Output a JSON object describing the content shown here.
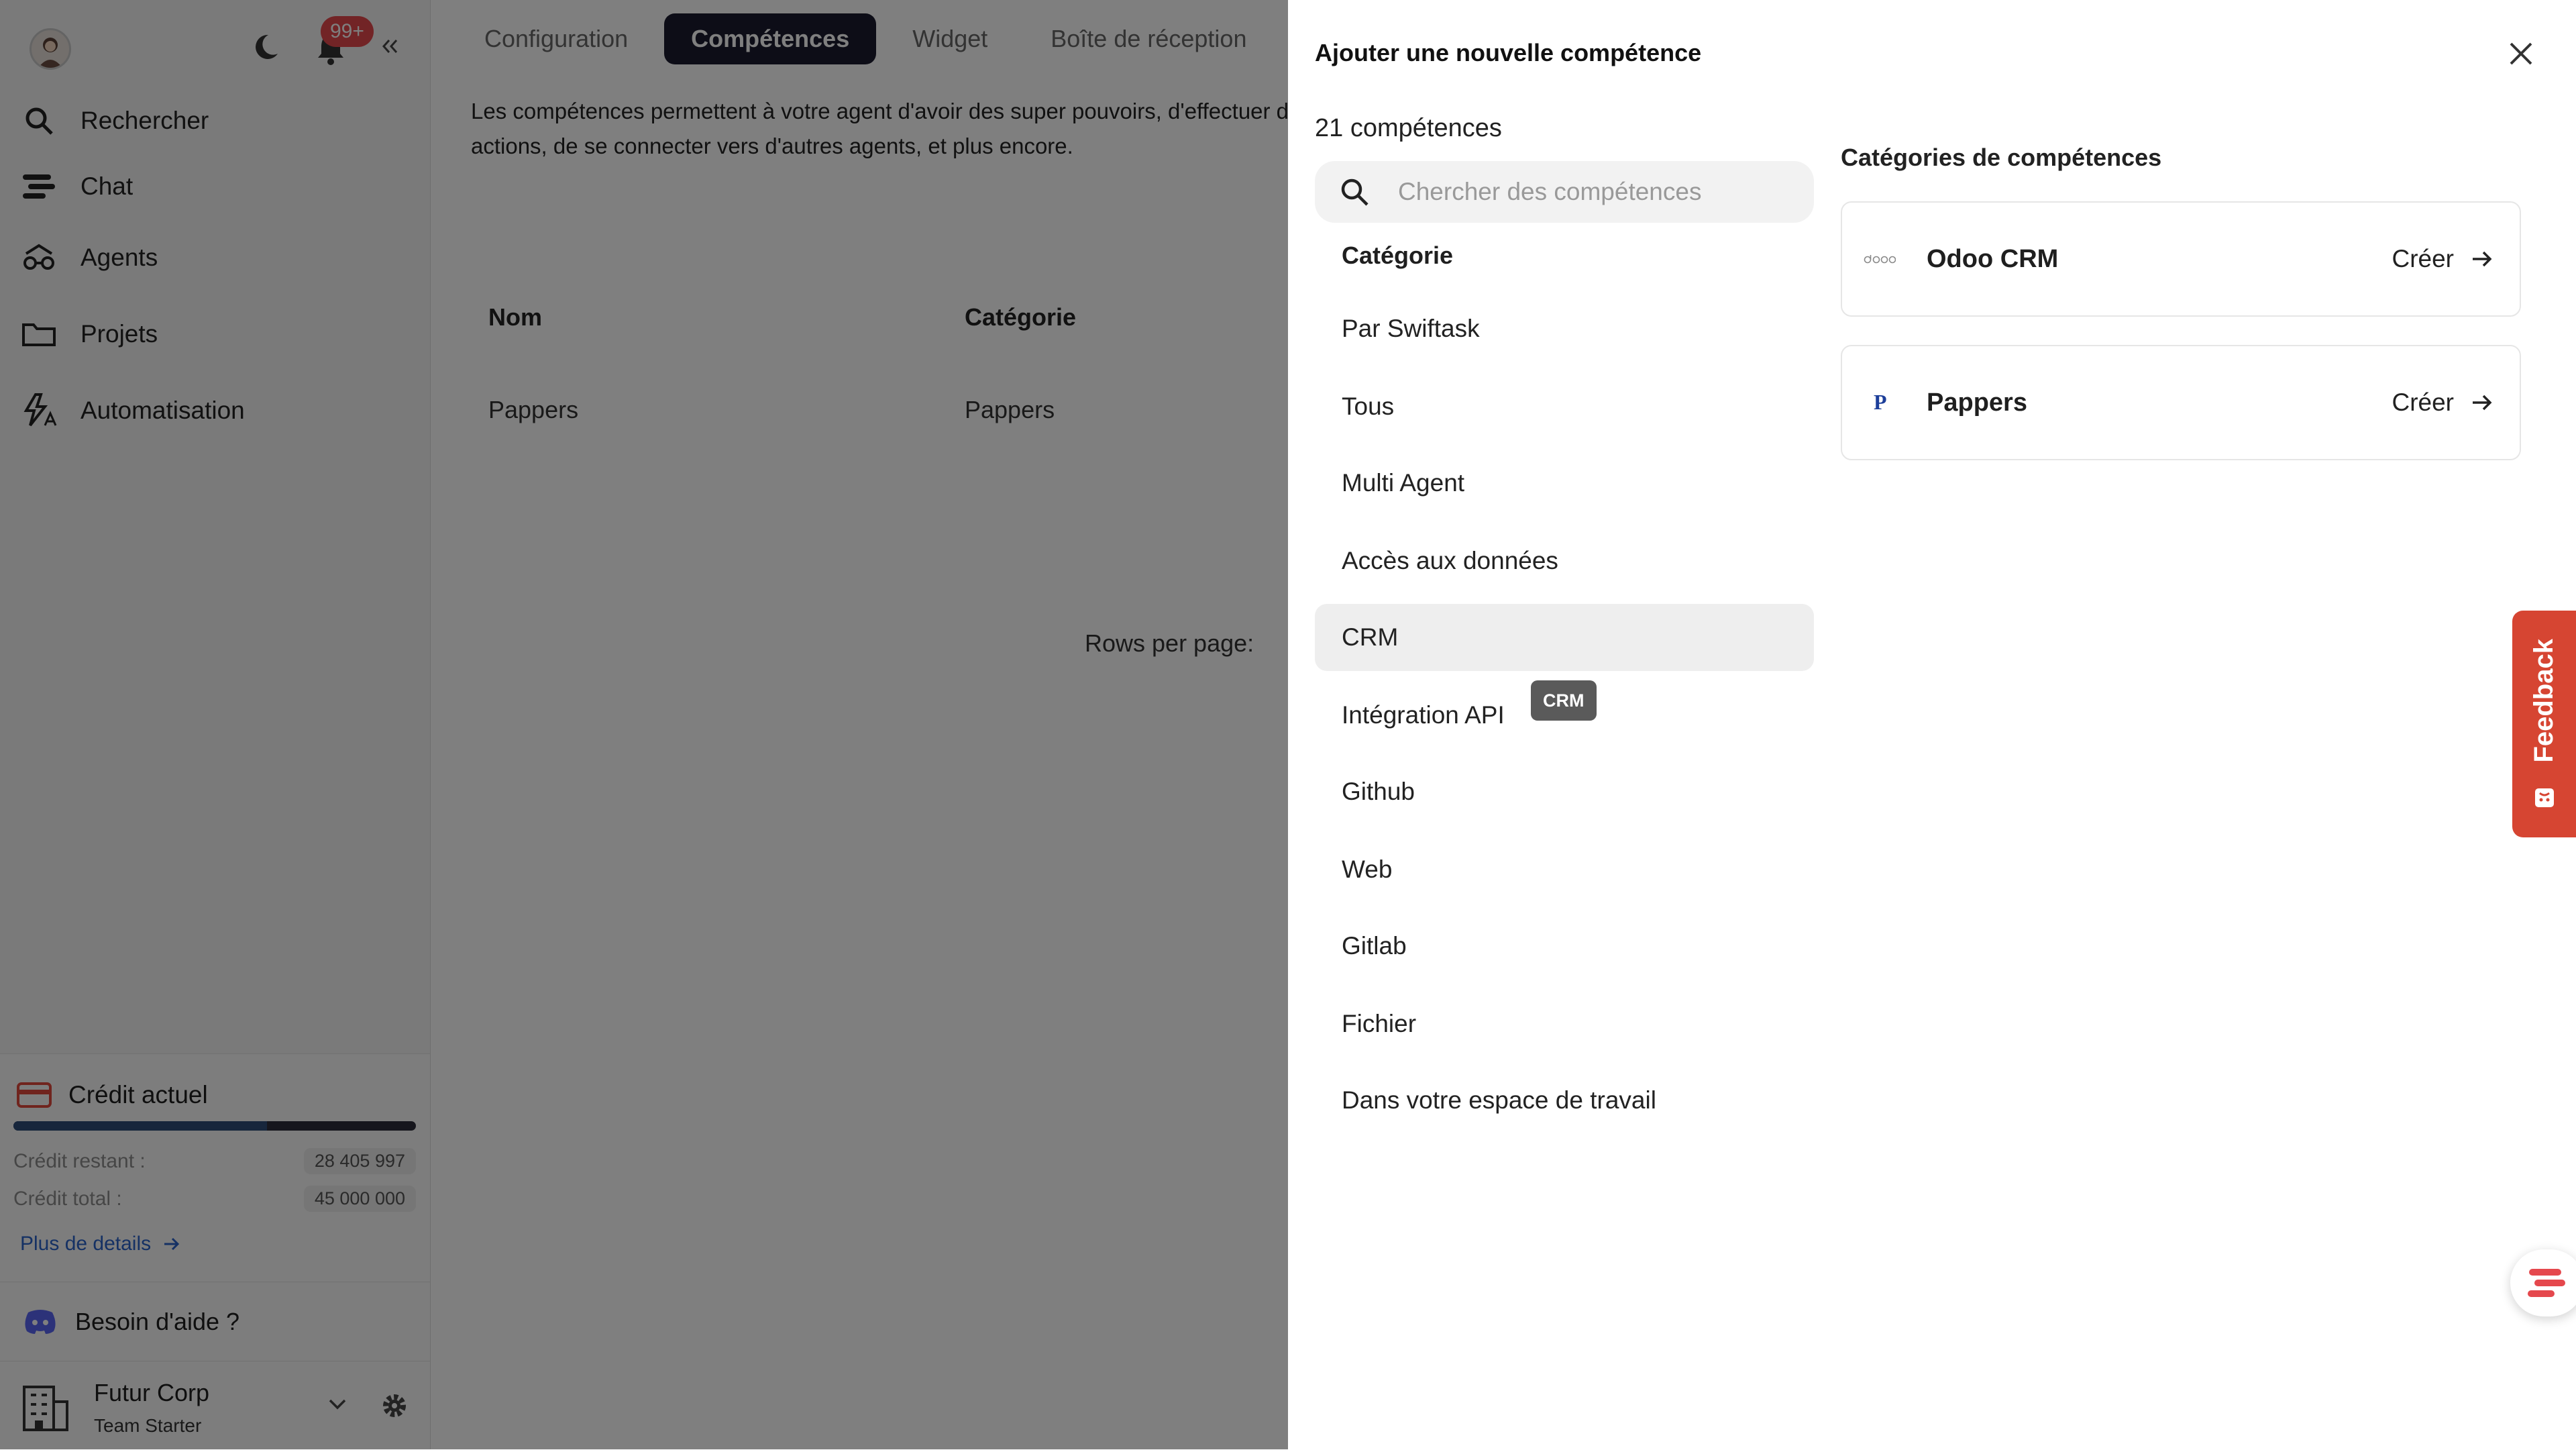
{
  "sidebar": {
    "notifications_badge": "99+",
    "nav": [
      {
        "label": "Rechercher",
        "icon": "search-icon"
      },
      {
        "label": "Chat",
        "icon": "chat-icon"
      },
      {
        "label": "Agents",
        "icon": "agents-icon"
      },
      {
        "label": "Projets",
        "icon": "folder-icon"
      },
      {
        "label": "Automatisation",
        "icon": "automation-icon"
      }
    ],
    "credit": {
      "title": "Crédit actuel",
      "progress_fraction": 0.63,
      "remaining_label": "Crédit restant :",
      "remaining_value": "28 405 997",
      "total_label": "Crédit total :",
      "total_value": "45 000 000",
      "details_link": "Plus de details"
    },
    "help_label": "Besoin d'aide ?",
    "workspace": {
      "name": "Futur Corp",
      "plan": "Team Starter"
    }
  },
  "main": {
    "tabs": [
      {
        "label": "Configuration"
      },
      {
        "label": "Compétences",
        "active": true
      },
      {
        "label": "Widget"
      },
      {
        "label": "Boîte de réception"
      }
    ],
    "description": "Les compétences permettent à votre agent d'avoir des super pouvoirs, d'effectuer des actions, de se connecter vers d'autres agents, et plus encore.",
    "table": {
      "headers": [
        "Nom",
        "Catégorie"
      ],
      "rows": [
        [
          "Pappers",
          "Pappers"
        ]
      ]
    },
    "rows_per_page_label": "Rows per page:"
  },
  "panel": {
    "title": "Ajouter une nouvelle compétence",
    "count": "21 compétences",
    "search_placeholder": "Chercher des compétences",
    "category_heading": "Catégorie",
    "categories": [
      "Par Swiftask",
      "Tous",
      "Multi Agent",
      "Accès aux données",
      "CRM",
      "Intégration API",
      "Github",
      "Web",
      "Gitlab",
      "Fichier",
      "Dans votre espace de travail"
    ],
    "selected_category": "CRM",
    "tooltip": "CRM",
    "right_heading": "Catégories de compétences",
    "skills": [
      {
        "name": "Odoo CRM",
        "logo_text": "odoo",
        "action": "Créer"
      },
      {
        "name": "Pappers",
        "logo_text": "P",
        "action": "Créer"
      }
    ]
  },
  "feedback_label": "Feedback",
  "colors": {
    "accent_dark": "#1a1b2e",
    "feedback": "#d64532",
    "link": "#2a62c9",
    "badge": "#e5484d"
  }
}
